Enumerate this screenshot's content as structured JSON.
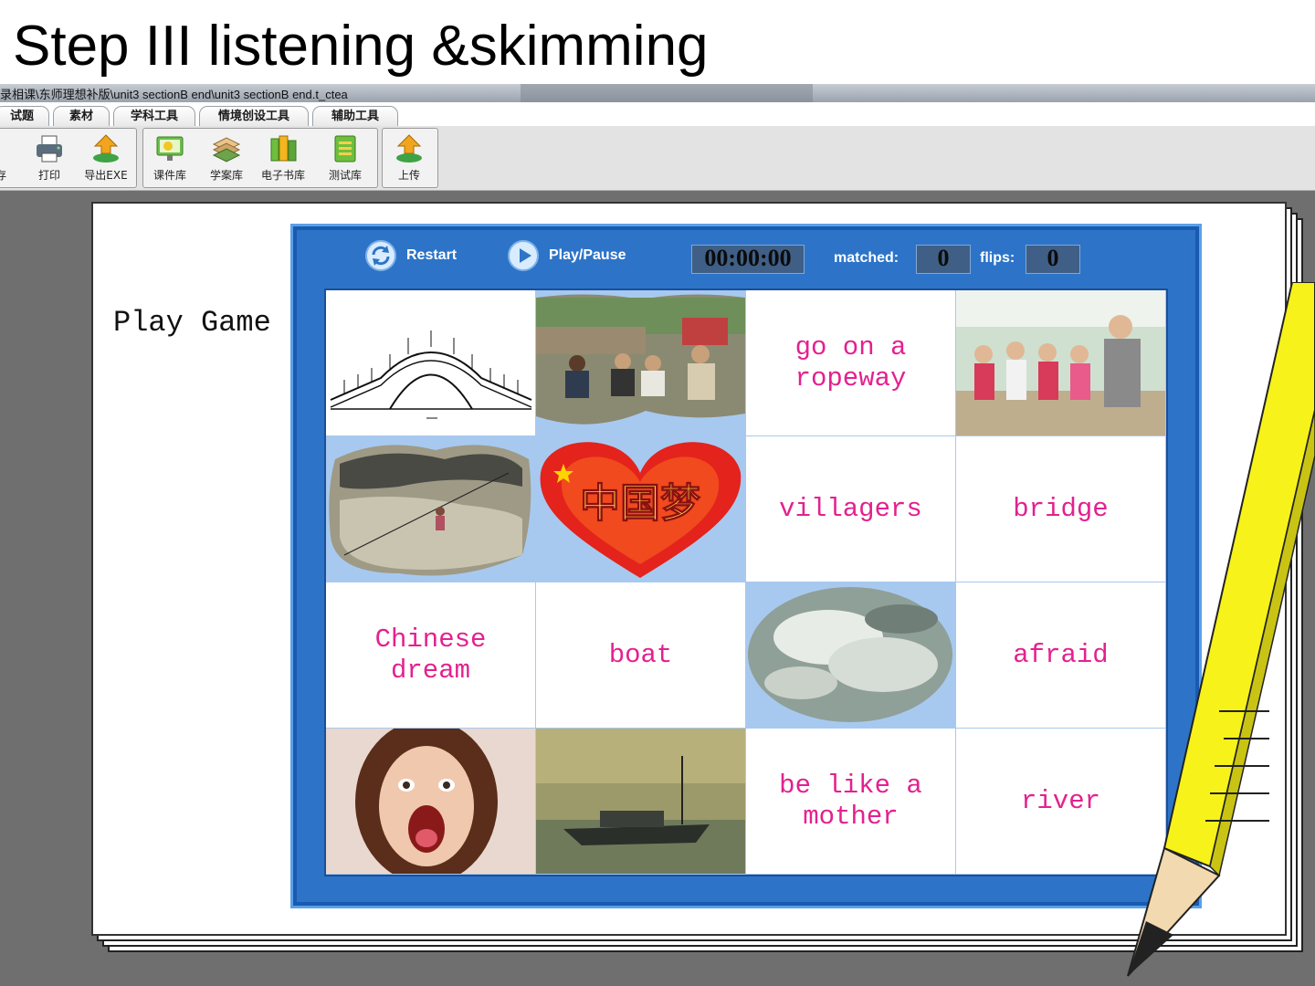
{
  "slide": {
    "title": "Step III listening &skimming"
  },
  "window": {
    "title": "录相课\\东师理想补版\\unit3 sectionB end\\unit3 sectionB end.t_ctea",
    "menu_tabs": [
      "试题",
      "素材",
      "学科工具",
      "情境创设工具",
      "辅助工具"
    ],
    "toolbar": [
      {
        "label": "存",
        "icon": "save-icon"
      },
      {
        "label": "打印",
        "icon": "printer-icon"
      },
      {
        "label": "导出EXE",
        "icon": "export-exe-icon"
      },
      {
        "label": "课件库",
        "icon": "courseware-library-icon"
      },
      {
        "label": "学案库",
        "icon": "study-plan-library-icon"
      },
      {
        "label": "电子书库",
        "icon": "ebook-library-icon"
      },
      {
        "label": "测试库",
        "icon": "test-library-icon"
      },
      {
        "label": "上传",
        "icon": "upload-icon"
      }
    ]
  },
  "page": {
    "label": "Play Game"
  },
  "game": {
    "restart_label": "Restart",
    "playpause_label": "Play/Pause",
    "timer": "00:00:00",
    "matched_label": "matched:",
    "matched_value": "0",
    "flips_label": "flips:",
    "flips_value": "0",
    "cards": [
      {
        "type": "image",
        "depicts": "bridge-drawing"
      },
      {
        "type": "image",
        "depicts": "villagers-photo"
      },
      {
        "type": "word",
        "text": "go on a\nropeway"
      },
      {
        "type": "image",
        "depicts": "teacher-children-photo"
      },
      {
        "type": "image",
        "depicts": "ropeway-river-photo"
      },
      {
        "type": "image",
        "depicts": "chinese-dream-heart",
        "caption": "中国梦"
      },
      {
        "type": "word",
        "text": "villagers"
      },
      {
        "type": "word",
        "text": "bridge"
      },
      {
        "type": "word",
        "text": "Chinese\ndream"
      },
      {
        "type": "word",
        "text": "boat"
      },
      {
        "type": "image",
        "depicts": "river-water-photo"
      },
      {
        "type": "word",
        "text": "afraid"
      },
      {
        "type": "image",
        "depicts": "afraid-girl-photo"
      },
      {
        "type": "image",
        "depicts": "boat-photo"
      },
      {
        "type": "word",
        "text": "be like a\nmother"
      },
      {
        "type": "word",
        "text": "river"
      }
    ]
  },
  "colors": {
    "word": "#e3218f",
    "frame": "#2d74c8",
    "card_bg": "#a8c9ef",
    "pencil": "#f7f21a"
  }
}
